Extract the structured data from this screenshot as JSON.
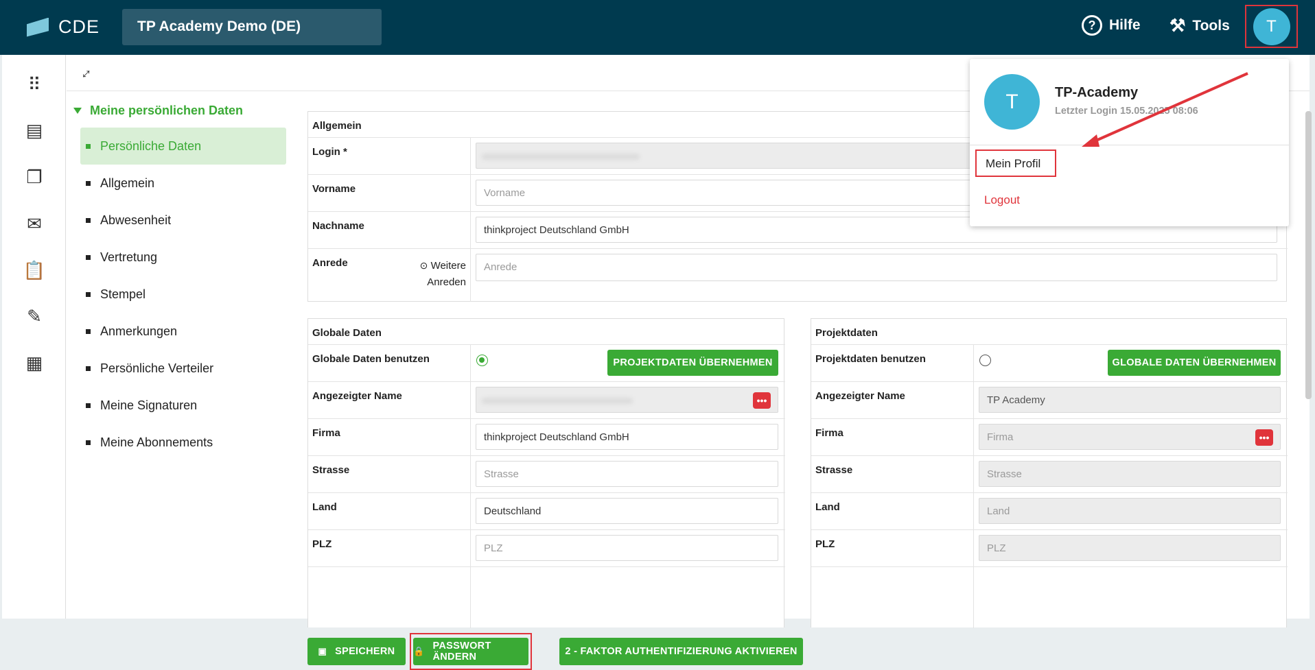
{
  "app": {
    "logo": "CDE",
    "project": "TP Academy Demo (DE)",
    "help": "Hilfe",
    "tools": "Tools",
    "avatar_letter": "T"
  },
  "sidebar_icons": [
    "apps-icon",
    "news-icon",
    "documents-icon",
    "mail-icon",
    "clipboard-icon",
    "tools-icon",
    "calendar-icon"
  ],
  "tree": {
    "title": "Meine persönlichen Daten",
    "items": [
      "Persönliche Daten",
      "Allgemein",
      "Abwesenheit",
      "Vertretung",
      "Stempel",
      "Anmerkungen",
      "Persönliche Verteiler",
      "Meine Signaturen",
      "Meine Abonnements"
    ]
  },
  "allgemein": {
    "title": "Allgemein",
    "login_label": "Login *",
    "vorname_label": "Vorname",
    "vorname_placeholder": "Vorname",
    "nachname_label": "Nachname",
    "nachname_value": "thinkproject Deutschland GmbH",
    "anrede_label": "Anrede",
    "weitere": "Weitere",
    "anreden": "Anreden",
    "anrede_placeholder": "Anrede"
  },
  "global": {
    "title": "Globale Daten",
    "use_label": "Globale Daten benutzen",
    "btn": "PROJEKTDATEN ÜBERNEHMEN",
    "name_label": "Angezeigter Name",
    "firma_label": "Firma",
    "firma_value": "thinkproject Deutschland GmbH",
    "strasse_label": "Strasse",
    "strasse_ph": "Strasse",
    "land_label": "Land",
    "land_value": "Deutschland",
    "plz_label": "PLZ",
    "plz_ph": "PLZ"
  },
  "projekt": {
    "title": "Projektdaten",
    "use_label": "Projektdaten benutzen",
    "btn": "GLOBALE DATEN ÜBERNEHMEN",
    "name_label": "Angezeigter Name",
    "name_value": "TP Academy",
    "firma_label": "Firma",
    "firma_ph": "Firma",
    "strasse_label": "Strasse",
    "strasse_ph": "Strasse",
    "land_label": "Land",
    "land_ph": "Land",
    "plz_label": "PLZ",
    "plz_ph": "PLZ"
  },
  "buttons": {
    "save": "SPEICHERN",
    "password": "PASSWORT ÄNDERN",
    "twofa": "2 - FAKTOR AUTHENTIFIZIERUNG AKTIVIEREN"
  },
  "dropdown": {
    "letter": "T",
    "name": "TP-Academy",
    "last_login": "Letzter Login 15.05.2025 08:06",
    "profile": "Mein Profil",
    "logout": "Logout"
  },
  "colors": {
    "topbar": "#003a4f",
    "accent": "#3aaa35",
    "highlight": "#e0343b",
    "avatar": "#3fb5d6"
  }
}
